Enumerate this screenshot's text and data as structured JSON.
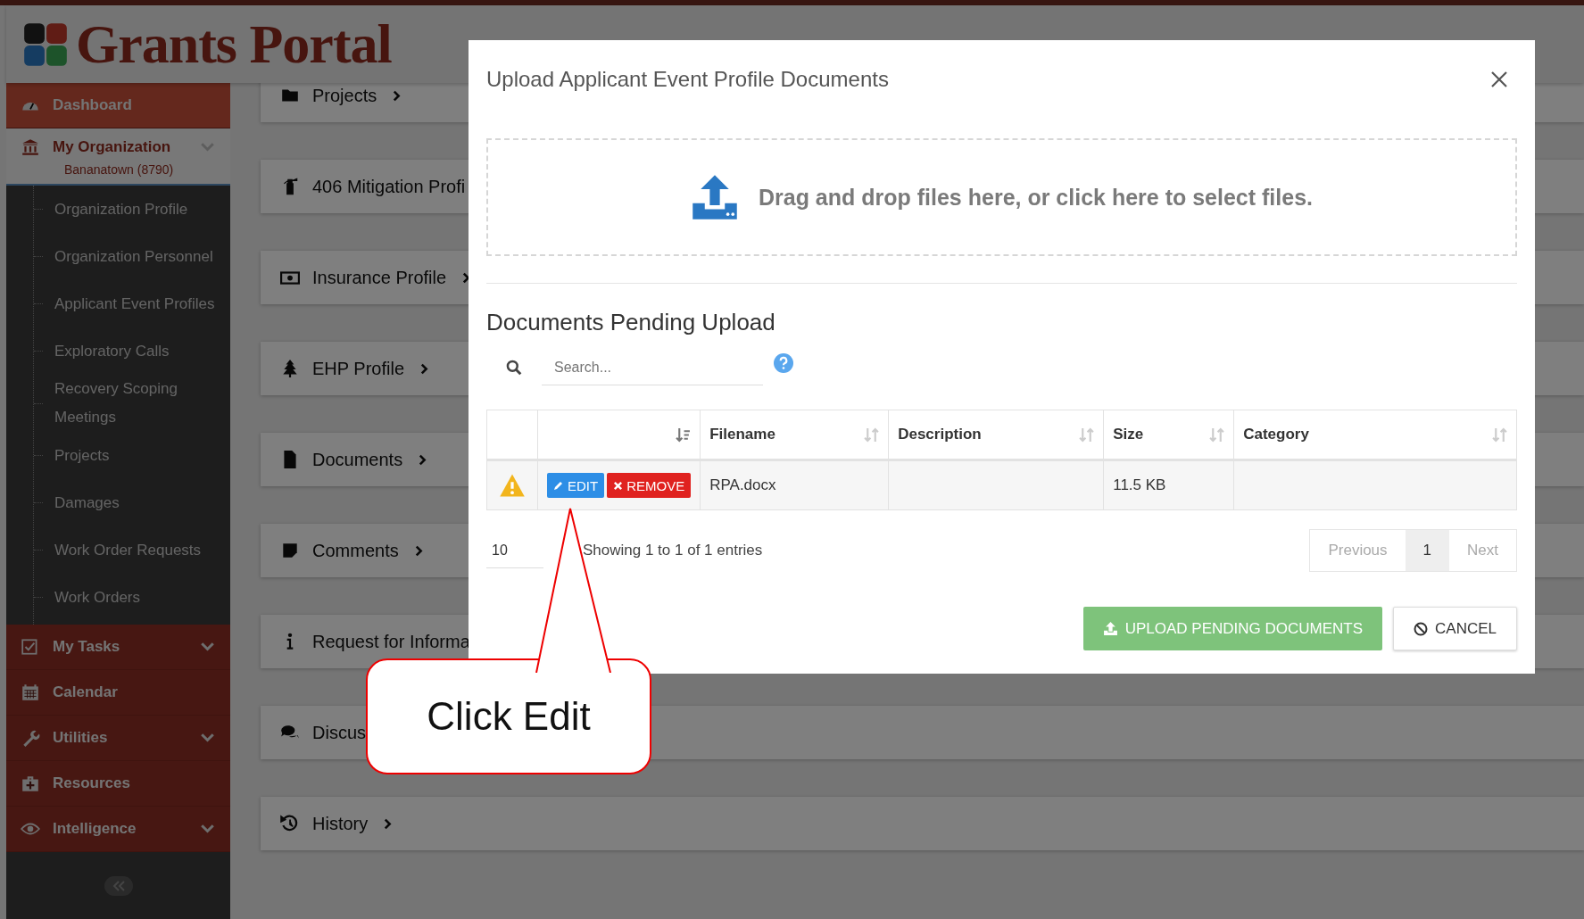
{
  "header": {
    "logo_text": "Grants Portal"
  },
  "sidebar": {
    "items": [
      {
        "label": "Dashboard",
        "selected": true,
        "chevron": false
      },
      {
        "label": "My Organization",
        "chevron": true,
        "subtitle": "Bananatown (8790)",
        "children": [
          {
            "label": "Organization Profile"
          },
          {
            "label": "Organization Personnel"
          },
          {
            "label": "Applicant Event Profiles"
          },
          {
            "label": "Exploratory Calls"
          },
          {
            "label": "Recovery Scoping Meetings"
          },
          {
            "label": "Projects"
          },
          {
            "label": "Damages"
          },
          {
            "label": "Work Order Requests"
          },
          {
            "label": "Work Orders"
          }
        ]
      },
      {
        "label": "My Tasks",
        "selected": false,
        "chevron": true
      },
      {
        "label": "Calendar",
        "selected": false,
        "chevron": false
      },
      {
        "label": "Utilities",
        "selected": false,
        "chevron": true
      },
      {
        "label": "Resources",
        "selected": false,
        "chevron": false
      },
      {
        "label": "Intelligence",
        "selected": false,
        "chevron": true
      }
    ]
  },
  "sections": [
    {
      "label": "Projects",
      "chevron": true
    },
    {
      "label": "406 Mitigation Profi"
    },
    {
      "label": "Insurance Profile",
      "chevron": true
    },
    {
      "label": "EHP Profile",
      "chevron": true
    },
    {
      "label": "Documents",
      "chevron": true
    },
    {
      "label": "Comments",
      "chevron": true
    },
    {
      "label": "Request for Informa"
    },
    {
      "label": "Discus"
    },
    {
      "label": "History",
      "chevron": true
    }
  ],
  "dialog": {
    "title": "Upload Applicant Event Profile Documents",
    "dropzone": {
      "text": "Drag and drop files here, or click here to select files."
    },
    "heading": "Documents Pending Upload",
    "search": {
      "placeholder": "Search..."
    },
    "table": {
      "columns": [
        {
          "sorted": true
        },
        {
          "label": "Filename",
          "sorted": false
        },
        {
          "label": "Description",
          "sorted": false
        },
        {
          "label": "Size",
          "sorted": false
        },
        {
          "label": "Category",
          "sorted": false
        }
      ],
      "rows": [
        {
          "warning": true,
          "actions": [
            {
              "label": "EDIT",
              "kind": "edit"
            },
            {
              "label": "REMOVE",
              "kind": "remove"
            }
          ],
          "filename": "RPA.docx",
          "size": "11.5 KB"
        }
      ]
    },
    "page_size": "10",
    "info": "Showing 1 to 1 of 1 entries",
    "pager": [
      {
        "label": "Previous",
        "selected": false,
        "disabled": true
      },
      {
        "label": "1",
        "selected": true,
        "disabled": false
      },
      {
        "label": "Next",
        "selected": false,
        "disabled": true
      }
    ],
    "buttons": [
      {
        "label": "UPLOAD PENDING DOCUMENTS",
        "kind": "upload"
      },
      {
        "label": "CANCEL",
        "kind": "cancel"
      }
    ]
  },
  "callout": {
    "text": "Click Edit"
  }
}
